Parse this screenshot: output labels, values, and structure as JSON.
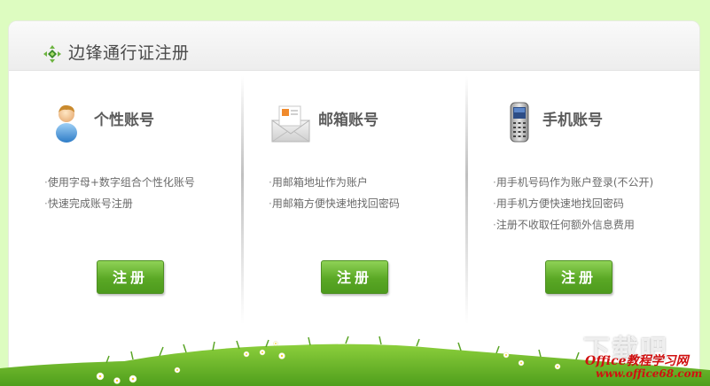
{
  "header": {
    "title": "边锋通行证注册",
    "icon": "diamond-arrows-icon"
  },
  "columns": [
    {
      "title": "个性账号",
      "icon": "user-avatar-icon",
      "features": [
        "使用字母+数字组合个性化账号",
        "快速完成账号注册"
      ],
      "button_label": "注册"
    },
    {
      "title": "邮箱账号",
      "icon": "envelope-icon",
      "features": [
        "用邮箱地址作为账户",
        "用邮箱方便快速地找回密码"
      ],
      "button_label": "注册"
    },
    {
      "title": "手机账号",
      "icon": "mobile-phone-icon",
      "features": [
        "用手机号码作为账户登录(不公开)",
        "用手机方便快速地找回密码",
        "注册不收取任何额外信息费用"
      ],
      "button_label": "注册"
    }
  ],
  "watermark": {
    "big_text": "下载吧",
    "line1": "Office教程学习网",
    "line2": "www.office68.com"
  },
  "colors": {
    "background": "#ddfcc0",
    "button_green": "#5aa825",
    "watermark_red": "#d01010"
  }
}
